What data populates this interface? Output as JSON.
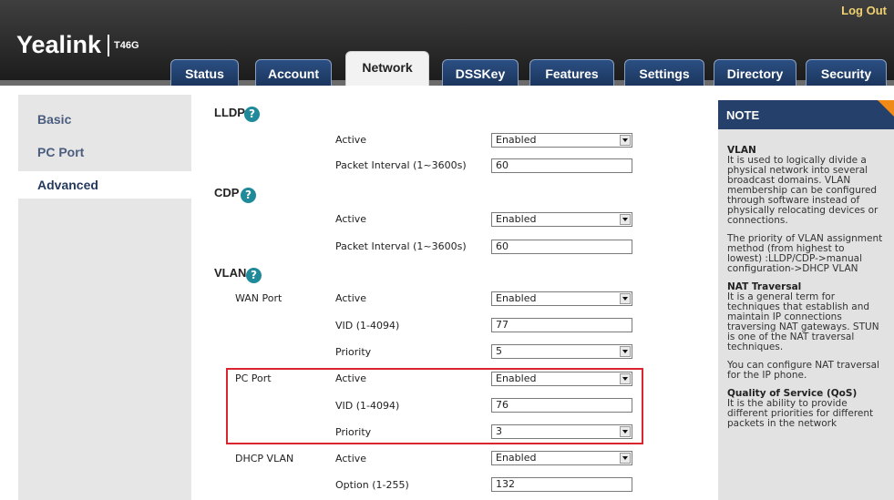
{
  "header": {
    "logo": "Yealink",
    "model": "T46G",
    "logout": "Log Out"
  },
  "tabs": [
    "Status",
    "Account",
    "Network",
    "DSSKey",
    "Features",
    "Settings",
    "Directory",
    "Security"
  ],
  "sidebar": {
    "items": [
      "Basic",
      "PC Port",
      "Advanced"
    ],
    "active": "Advanced"
  },
  "lldp": {
    "title": "LLDP",
    "active_label": "Active",
    "active_value": "Enabled",
    "interval_label": "Packet Interval (1~3600s)",
    "interval_value": "60"
  },
  "cdp": {
    "title": "CDP",
    "active_label": "Active",
    "active_value": "Enabled",
    "interval_label": "Packet Interval (1~3600s)",
    "interval_value": "60"
  },
  "vlan": {
    "title": "VLAN",
    "wan": {
      "label": "WAN Port",
      "active_label": "Active",
      "active_value": "Enabled",
      "vid_label": "VID (1-4094)",
      "vid_value": "77",
      "priority_label": "Priority",
      "priority_value": "5"
    },
    "pc": {
      "label": "PC Port",
      "active_label": "Active",
      "active_value": "Enabled",
      "vid_label": "VID (1-4094)",
      "vid_value": "76",
      "priority_label": "Priority",
      "priority_value": "3"
    },
    "dhcp": {
      "label": "DHCP VLAN",
      "active_label": "Active",
      "active_value": "Enabled",
      "option_label": "Option (1-255)",
      "option_value": "132"
    }
  },
  "note": {
    "title": "NOTE",
    "vlan_heading": "VLAN",
    "vlan_lines": [
      "It is used to logically divide a",
      "physical network into several",
      "broadcast domains. VLAN",
      "membership can be configured",
      "through software instead of",
      "physically relocating devices or",
      "connections."
    ],
    "priority_lines": [
      "The priority of VLAN assignment",
      "method (from highest to",
      "lowest) :LLDP/CDP->manual",
      "configuration->DHCP VLAN"
    ],
    "nat_heading": "NAT Traversal",
    "nat_lines": [
      "It is a general term for",
      "techniques that establish and",
      "maintain IP connections",
      "traversing NAT gateways. STUN",
      "is one of the NAT traversal",
      "techniques."
    ],
    "nat2_lines": [
      "You can configure NAT traversal",
      "for the IP phone."
    ],
    "qos_heading": "Quality of Service (QoS)",
    "qos_lines": [
      "It is the ability to provide",
      "different priorities for different",
      "packets in the network"
    ]
  },
  "colors": {
    "header": "#1a1a1a",
    "tab": "#1b355d",
    "note_header": "#25406a",
    "highlight": "#d9252f",
    "help": "#1e8a9a",
    "note_corner": "#f08a16"
  }
}
